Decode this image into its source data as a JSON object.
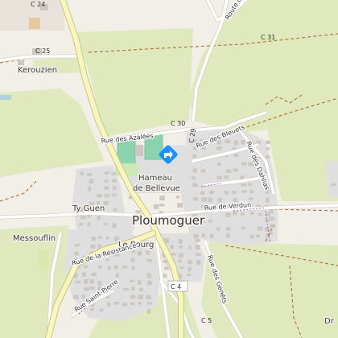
{
  "places": {
    "kerouzien": "Kerouzien",
    "messouflin": "Messouflin",
    "ty_guen": "Ty Guen",
    "hameau": "Hameau",
    "de_bellevue": "de Bellevue",
    "le_bourg": "Le Bourg",
    "town": "Ploumoguer",
    "dr": "Dr"
  },
  "roads": {
    "rue_azalees": "Rue des Azalées",
    "rue_bleuets": "Rue des Bleuets",
    "rue_dahlias": "Rue des Dahlias",
    "rue_verdun": "Rue de Verdun",
    "rue_resistance": "Rue de la Résistance",
    "rue_saint_pierre": "Rue Saint-Pierre",
    "rue_genets": "Rue des Genêts",
    "route_de": "Route de"
  },
  "refs": {
    "c24": "C 24",
    "c25": "C 25",
    "c30": "C 30",
    "c31": "C 31",
    "c29": "C 29",
    "c4": "C 4",
    "c5": "C 5"
  },
  "colors": {
    "land": "#f2efe9",
    "meadow": "#dfe9bd",
    "residential": "#e0dfdf",
    "building": "#cdc7c2",
    "road_outline": "#d6cfc4",
    "secondary_road": "#f7f6bd",
    "sports_pitch": "#8ad3ae",
    "poi_marker": "#1e90ff",
    "track": "#b07a3e"
  },
  "icons": {
    "poi": "diamond-direction-icon"
  }
}
